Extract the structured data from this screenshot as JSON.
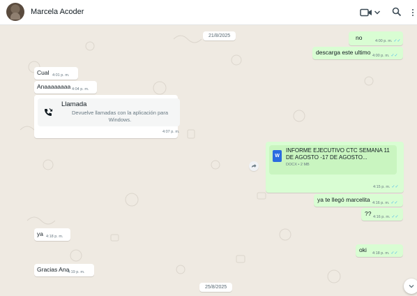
{
  "header": {
    "contact_name": "Marcela Acoder",
    "icons": [
      "video-call-icon",
      "chevron-down-icon",
      "search-icon",
      "more-options-icon"
    ]
  },
  "dates": [
    "21/8/2025",
    "25/8/2025"
  ],
  "messages": [
    {
      "dir": "out",
      "text": "no",
      "time": "4:00 p. m."
    },
    {
      "dir": "out",
      "text": "descarga este ultimo",
      "time": "4:00 p. m."
    },
    {
      "dir": "in",
      "text": "Cual",
      "time": "4:01 p. m."
    },
    {
      "dir": "in",
      "text": "Anaaaaaaaa",
      "time": "4:04 p. m."
    },
    {
      "dir": "in",
      "type": "call",
      "title": "Llamada",
      "subtitle": "Devuelve llamadas con la aplicación para Windows.",
      "time": "4:07 p. m."
    },
    {
      "dir": "out",
      "type": "document",
      "title": "INFORME EJECUTIVO CTC SEMANA 11 DE AGOSTO -17 DE AGOSTO...",
      "meta": "DOCX • 2 MB",
      "time": "4:15 p. m."
    },
    {
      "dir": "out",
      "text": "ya te llegó marcelita",
      "time": "4:16 p. m."
    },
    {
      "dir": "out",
      "text": "??",
      "time": "4:16 p. m."
    },
    {
      "dir": "in",
      "text": "ya",
      "time": "4:18 p. m."
    },
    {
      "dir": "out",
      "text": "oki",
      "time": "4:18 p. m."
    },
    {
      "dir": "in",
      "text": "Gracias Ana",
      "time": "4:19 p. m."
    }
  ],
  "colors": {
    "chat_bg": "#efeae2",
    "outgoing_bubble": "#d9fdd3",
    "incoming_bubble": "#ffffff",
    "read_ticks": "#53bdeb"
  }
}
